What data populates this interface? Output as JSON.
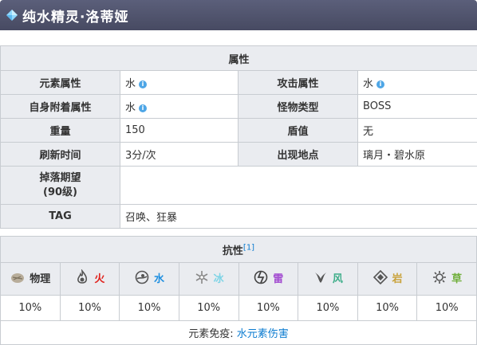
{
  "header": {
    "title": "纯水精灵·洛蒂娅",
    "icon": "hydro-gem-icon"
  },
  "info": {
    "section_title": "属性",
    "rows": [
      {
        "l1": "元素属性",
        "v1": "水",
        "i1": true,
        "l2": "攻击属性",
        "v2": "水",
        "i2": true
      },
      {
        "l1": "自身附着属性",
        "v1": "水",
        "i1": true,
        "l2": "怪物类型",
        "v2": "BOSS",
        "i2": false
      },
      {
        "l1": "重量",
        "v1": "150",
        "i1": false,
        "l2": "盾值",
        "v2": "无",
        "i2": false
      },
      {
        "l1": "刷新时间",
        "v1": "3分/次",
        "i1": false,
        "l2": "出现地点",
        "v2": "璃月・碧水原",
        "i2": false
      }
    ],
    "drop_label_line1": "掉落期望",
    "drop_label_line2": "(90级)",
    "drop_value": "",
    "tag_label": "TAG",
    "tag_value": "召唤、狂暴"
  },
  "resist": {
    "section_title": "抗性",
    "footnote": "[1]",
    "elements": [
      {
        "name": "物理",
        "color": "#333333",
        "icon": "physical-icon",
        "value": "10%"
      },
      {
        "name": "火",
        "color": "#e0201b",
        "icon": "pyro-icon",
        "value": "10%"
      },
      {
        "name": "水",
        "color": "#1f8fe0",
        "icon": "hydro-icon",
        "value": "10%"
      },
      {
        "name": "冰",
        "color": "#7fd4e6",
        "icon": "cryo-icon",
        "value": "10%"
      },
      {
        "name": "雷",
        "color": "#a24bd0",
        "icon": "electro-icon",
        "value": "10%"
      },
      {
        "name": "风",
        "color": "#3fae8a",
        "icon": "anemo-icon",
        "value": "10%"
      },
      {
        "name": "岩",
        "color": "#c9a23a",
        "icon": "geo-icon",
        "value": "10%"
      },
      {
        "name": "草",
        "color": "#6fae3a",
        "icon": "dendro-icon",
        "value": "10%"
      }
    ],
    "immunity_label": "元素免疫:",
    "immunity_value": "水元素伤害"
  }
}
